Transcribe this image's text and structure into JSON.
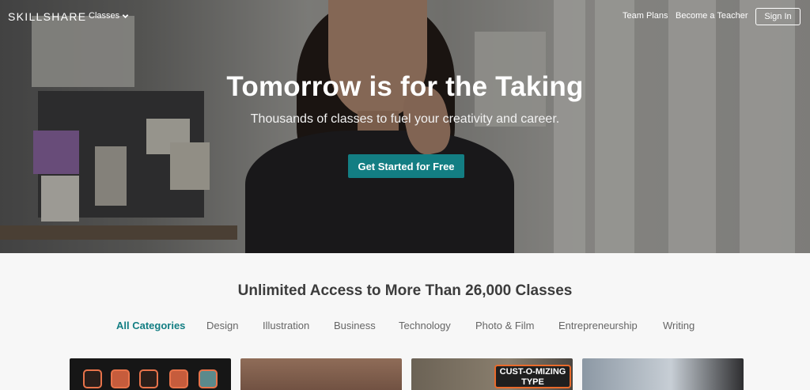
{
  "nav": {
    "logo": "SKILLSHARE",
    "classes_label": "Classes",
    "team_plans": "Team Plans",
    "become_teacher": "Become a Teacher",
    "sign_in": "Sign In"
  },
  "hero": {
    "title": "Tomorrow is for the Taking",
    "subtitle": "Thousands of classes to fuel your creativity and career.",
    "cta": "Get Started for Free"
  },
  "catalog": {
    "heading": "Unlimited Access to More Than 26,000 Classes",
    "tabs": [
      "All Categories",
      "Design",
      "Illustration",
      "Business",
      "Technology",
      "Photo & Film",
      "Entrepreneurship",
      "Writing"
    ],
    "active_tab": "All Categories",
    "card3_overlay": "CUST-O-MIZING TYPE"
  },
  "colors": {
    "accent": "#137e83"
  }
}
